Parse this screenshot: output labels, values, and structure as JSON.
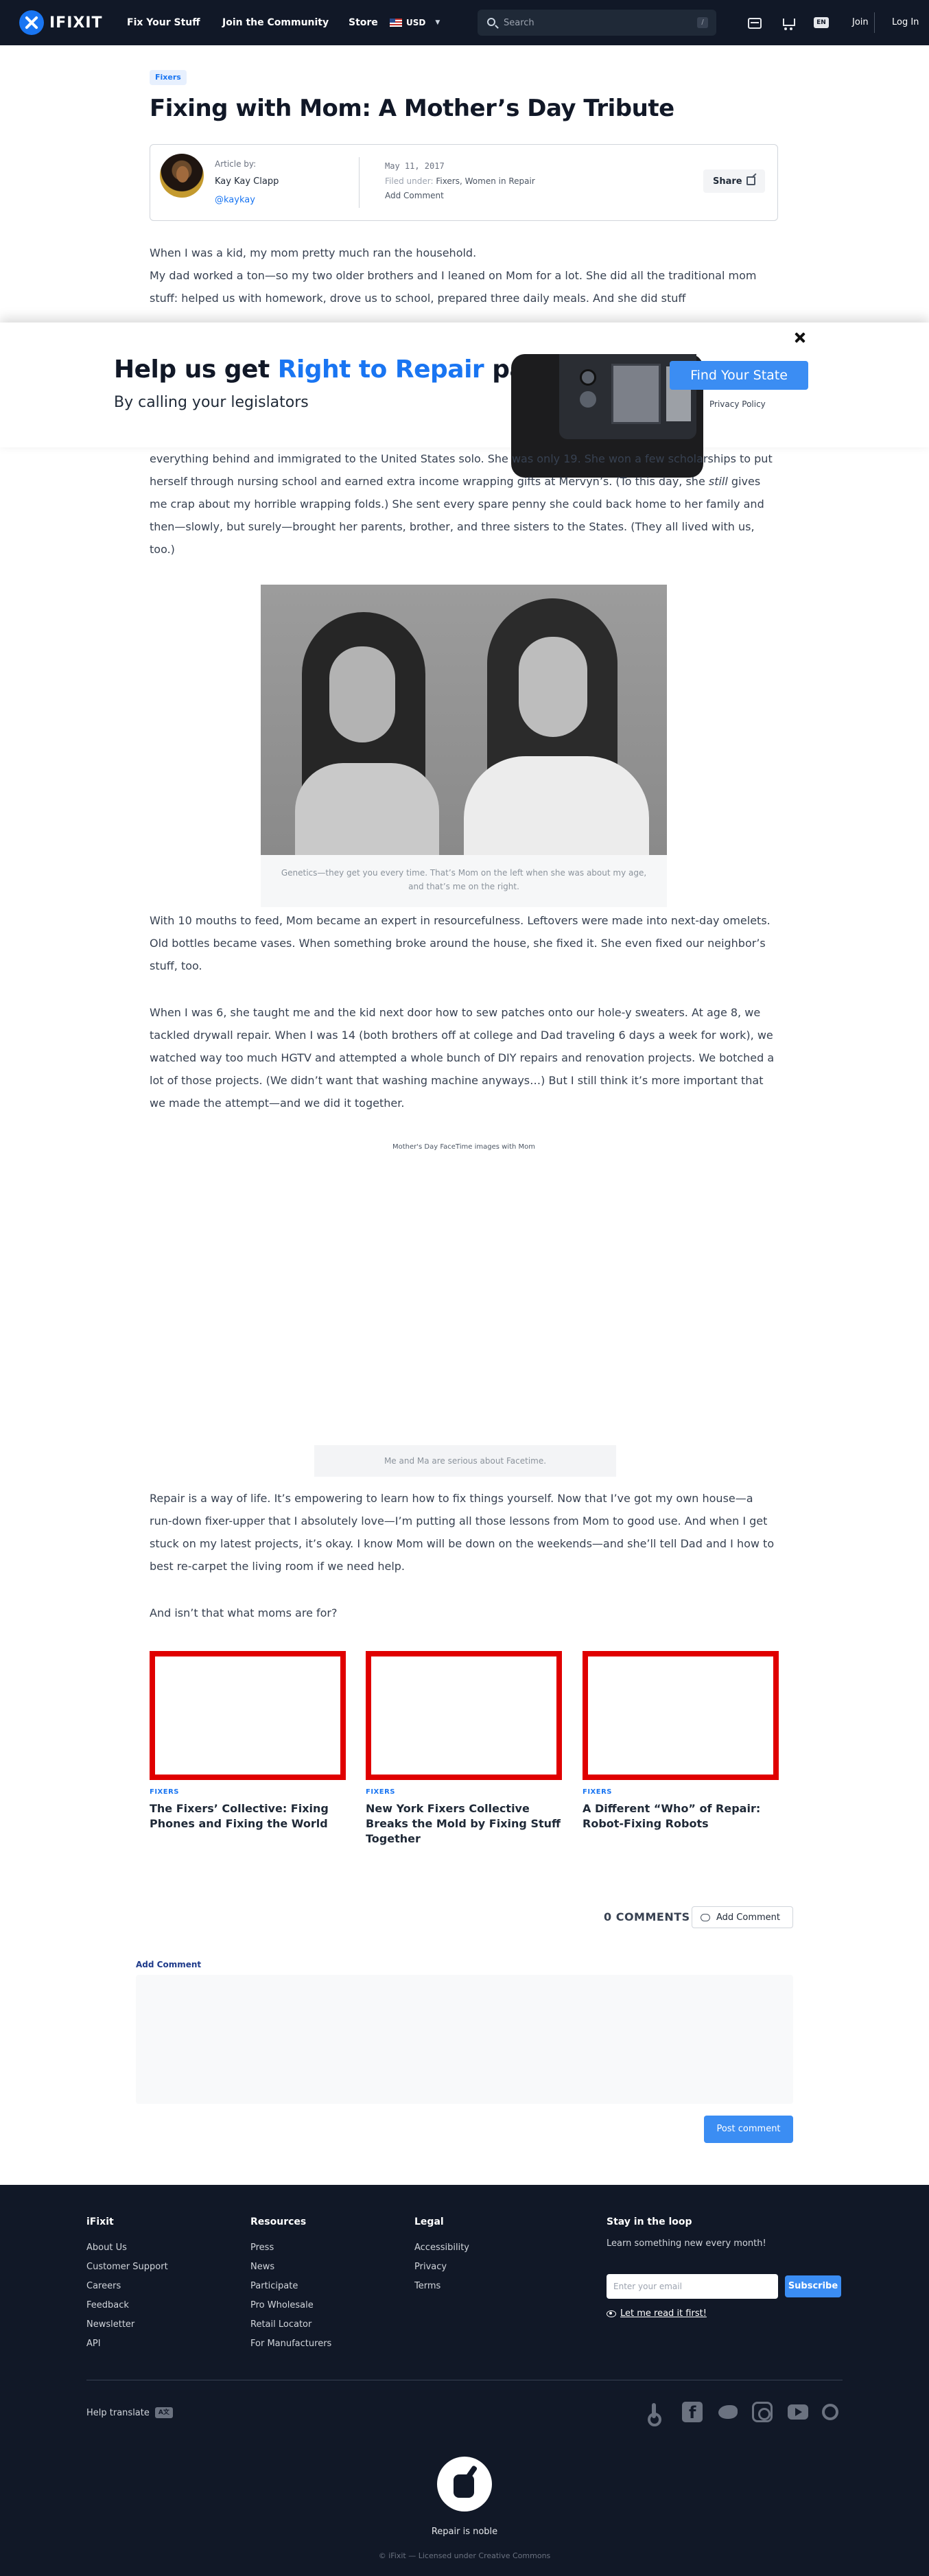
{
  "nav": {
    "logo": "IFIXIT",
    "links": [
      "Fix Your Stuff",
      "Join the Community",
      "Store"
    ],
    "currency": "USD",
    "search_placeholder": "Search",
    "search_shortcut": "/",
    "lang": "EN",
    "join": "Join",
    "login": "Log In"
  },
  "article": {
    "tag": "Fixers",
    "title": "Fixing with Mom: A Mother’s Day Tribute",
    "article_by": "Article by:",
    "author": "Kay Kay Clapp",
    "handle": "@kaykay",
    "date": "May 11, 2017",
    "filed_label": "Filed under:",
    "filed_cats": "Fixers, Women in Repair",
    "add_comment": "Add Comment",
    "share": "Share",
    "p1": "When I was a kid, my mom pretty much ran the household.",
    "p2": "My dad worked a ton—so my two older brothers and I leaned on Mom for a lot. She did all the traditional mom stuff: helped us with homework, drove us to school, prepared three daily meals. And she did stuff",
    "p3_a": "everything behind and immigrated to the United States solo. She was only 19. She won a few scholarships to put herself through nursing school and earned extra income wrapping gifts at Mervyn’s. (To this day, she ",
    "p3_em": "still",
    "p3_b": " gives me crap about my horrible wrapping folds.) She sent every spare penny she could back home to her family and then—slowly, but surely—brought her parents, brother, and three sisters to the States. (They all lived with us, too.)",
    "fig1_caption": "Genetics—they get you every time. That’s Mom on the left when she was about my age, and that’s me on the right.",
    "p4": "With 10 mouths to feed, Mom became an expert in resourcefulness. Leftovers were made into next-day omelets. Old bottles became vases. When something broke around the house, she fixed it. She even fixed our neighbor’s stuff, too.",
    "p5": "When I was 6, she taught me and the kid next door how to sew patches onto our hole-y sweaters. At age 8, we tackled drywall repair. When I was 14 (both brothers off at college and Dad traveling 6 days a week for work), we watched way too much HGTV and attempted a whole bunch of DIY repairs and renovation projects. We botched a lot of those projects. (We didn’t want that washing machine anyways…) But I still think it’s more important that we made the attempt—and we did it together.",
    "embed_title": "Mother's Day FaceTime images with Mom",
    "fig2_caption": "Me and Ma are serious about Facetime.",
    "p6": "Repair is a way of life. It’s empowering to learn how to fix things yourself. Now that I’ve got my own house—a run-down fixer-upper that I absolutely love—I’m putting all those lessons from Mom to good use. And when I get stuck on my latest projects, it’s okay. I know Mom will be down on the weekends—and she’ll tell Dad and I how to best re-carpet the living room if we need help.",
    "p7": "And isn’t that what moms are for?"
  },
  "banner": {
    "title_a": "Help us get ",
    "title_hl": "Right to Repair",
    "title_b": " passed",
    "subtitle": "By calling your legislators",
    "cta": "Find Your State",
    "privacy": "Privacy Policy"
  },
  "related": [
    {
      "category": "FIXERS",
      "title": "The Fixers’ Collective: Fixing Phones and Fixing the World"
    },
    {
      "category": "FIXERS",
      "title": "New York Fixers Collective Breaks the Mold by Fixing Stuff Together"
    },
    {
      "category": "FIXERS",
      "title": "A Different “Who” of Repair: Robot-Fixing Robots"
    }
  ],
  "comments": {
    "count": "0 COMMENTS",
    "add_button": "Add Comment",
    "label": "Add Comment",
    "post": "Post comment"
  },
  "footer": {
    "col1": {
      "title": "iFixit",
      "links": [
        "About Us",
        "Customer Support",
        "Careers",
        "Feedback",
        "Newsletter",
        "API"
      ]
    },
    "col2": {
      "title": "Resources",
      "links": [
        "Press",
        "News",
        "Participate",
        "Pro Wholesale",
        "Retail Locator",
        "For Manufacturers"
      ]
    },
    "col3": {
      "title": "Legal",
      "links": [
        "Accessibility",
        "Privacy",
        "Terms"
      ]
    },
    "stay": {
      "title": "Stay in the loop",
      "text": "Learn something new every month!",
      "placeholder": "Enter your email",
      "subscribe": "Subscribe",
      "read_first": "Let me read it first!"
    },
    "help_translate": "Help translate",
    "tagline": "Repair is noble",
    "copyright": "© iFixit — Licensed under Creative Commons"
  },
  "colors": {
    "brand_blue": "#1975f2",
    "nav_bg": "#111827",
    "related_border": "#e00000"
  }
}
